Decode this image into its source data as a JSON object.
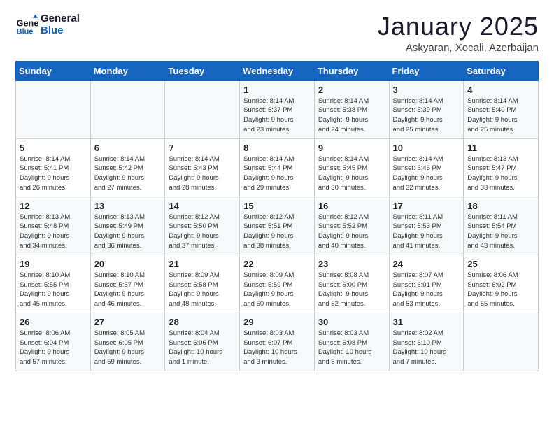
{
  "header": {
    "logo_line1": "General",
    "logo_line2": "Blue",
    "month": "January 2025",
    "location": "Askyaran, Xocali, Azerbaijan"
  },
  "weekdays": [
    "Sunday",
    "Monday",
    "Tuesday",
    "Wednesday",
    "Thursday",
    "Friday",
    "Saturday"
  ],
  "weeks": [
    [
      {
        "day": "",
        "info": ""
      },
      {
        "day": "",
        "info": ""
      },
      {
        "day": "",
        "info": ""
      },
      {
        "day": "1",
        "info": "Sunrise: 8:14 AM\nSunset: 5:37 PM\nDaylight: 9 hours\nand 23 minutes."
      },
      {
        "day": "2",
        "info": "Sunrise: 8:14 AM\nSunset: 5:38 PM\nDaylight: 9 hours\nand 24 minutes."
      },
      {
        "day": "3",
        "info": "Sunrise: 8:14 AM\nSunset: 5:39 PM\nDaylight: 9 hours\nand 25 minutes."
      },
      {
        "day": "4",
        "info": "Sunrise: 8:14 AM\nSunset: 5:40 PM\nDaylight: 9 hours\nand 25 minutes."
      }
    ],
    [
      {
        "day": "5",
        "info": "Sunrise: 8:14 AM\nSunset: 5:41 PM\nDaylight: 9 hours\nand 26 minutes."
      },
      {
        "day": "6",
        "info": "Sunrise: 8:14 AM\nSunset: 5:42 PM\nDaylight: 9 hours\nand 27 minutes."
      },
      {
        "day": "7",
        "info": "Sunrise: 8:14 AM\nSunset: 5:43 PM\nDaylight: 9 hours\nand 28 minutes."
      },
      {
        "day": "8",
        "info": "Sunrise: 8:14 AM\nSunset: 5:44 PM\nDaylight: 9 hours\nand 29 minutes."
      },
      {
        "day": "9",
        "info": "Sunrise: 8:14 AM\nSunset: 5:45 PM\nDaylight: 9 hours\nand 30 minutes."
      },
      {
        "day": "10",
        "info": "Sunrise: 8:14 AM\nSunset: 5:46 PM\nDaylight: 9 hours\nand 32 minutes."
      },
      {
        "day": "11",
        "info": "Sunrise: 8:13 AM\nSunset: 5:47 PM\nDaylight: 9 hours\nand 33 minutes."
      }
    ],
    [
      {
        "day": "12",
        "info": "Sunrise: 8:13 AM\nSunset: 5:48 PM\nDaylight: 9 hours\nand 34 minutes."
      },
      {
        "day": "13",
        "info": "Sunrise: 8:13 AM\nSunset: 5:49 PM\nDaylight: 9 hours\nand 36 minutes."
      },
      {
        "day": "14",
        "info": "Sunrise: 8:12 AM\nSunset: 5:50 PM\nDaylight: 9 hours\nand 37 minutes."
      },
      {
        "day": "15",
        "info": "Sunrise: 8:12 AM\nSunset: 5:51 PM\nDaylight: 9 hours\nand 38 minutes."
      },
      {
        "day": "16",
        "info": "Sunrise: 8:12 AM\nSunset: 5:52 PM\nDaylight: 9 hours\nand 40 minutes."
      },
      {
        "day": "17",
        "info": "Sunrise: 8:11 AM\nSunset: 5:53 PM\nDaylight: 9 hours\nand 41 minutes."
      },
      {
        "day": "18",
        "info": "Sunrise: 8:11 AM\nSunset: 5:54 PM\nDaylight: 9 hours\nand 43 minutes."
      }
    ],
    [
      {
        "day": "19",
        "info": "Sunrise: 8:10 AM\nSunset: 5:55 PM\nDaylight: 9 hours\nand 45 minutes."
      },
      {
        "day": "20",
        "info": "Sunrise: 8:10 AM\nSunset: 5:57 PM\nDaylight: 9 hours\nand 46 minutes."
      },
      {
        "day": "21",
        "info": "Sunrise: 8:09 AM\nSunset: 5:58 PM\nDaylight: 9 hours\nand 48 minutes."
      },
      {
        "day": "22",
        "info": "Sunrise: 8:09 AM\nSunset: 5:59 PM\nDaylight: 9 hours\nand 50 minutes."
      },
      {
        "day": "23",
        "info": "Sunrise: 8:08 AM\nSunset: 6:00 PM\nDaylight: 9 hours\nand 52 minutes."
      },
      {
        "day": "24",
        "info": "Sunrise: 8:07 AM\nSunset: 6:01 PM\nDaylight: 9 hours\nand 53 minutes."
      },
      {
        "day": "25",
        "info": "Sunrise: 8:06 AM\nSunset: 6:02 PM\nDaylight: 9 hours\nand 55 minutes."
      }
    ],
    [
      {
        "day": "26",
        "info": "Sunrise: 8:06 AM\nSunset: 6:04 PM\nDaylight: 9 hours\nand 57 minutes."
      },
      {
        "day": "27",
        "info": "Sunrise: 8:05 AM\nSunset: 6:05 PM\nDaylight: 9 hours\nand 59 minutes."
      },
      {
        "day": "28",
        "info": "Sunrise: 8:04 AM\nSunset: 6:06 PM\nDaylight: 10 hours\nand 1 minute."
      },
      {
        "day": "29",
        "info": "Sunrise: 8:03 AM\nSunset: 6:07 PM\nDaylight: 10 hours\nand 3 minutes."
      },
      {
        "day": "30",
        "info": "Sunrise: 8:03 AM\nSunset: 6:08 PM\nDaylight: 10 hours\nand 5 minutes."
      },
      {
        "day": "31",
        "info": "Sunrise: 8:02 AM\nSunset: 6:10 PM\nDaylight: 10 hours\nand 7 minutes."
      },
      {
        "day": "",
        "info": ""
      }
    ]
  ]
}
